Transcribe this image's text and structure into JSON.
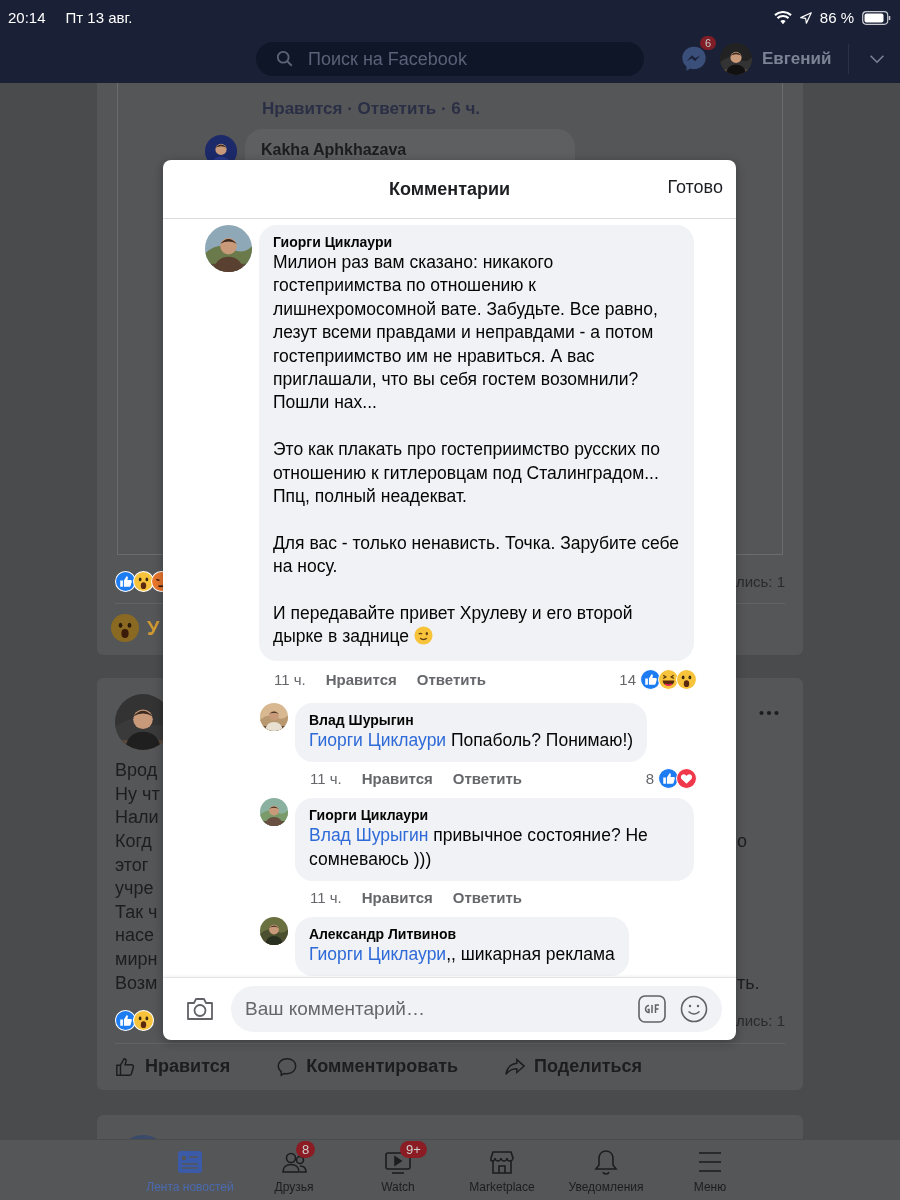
{
  "status_bar": {
    "time": "20:14",
    "date": "Пт 13 авг.",
    "battery": "86 %"
  },
  "top_bar": {
    "search_placeholder": "Поиск на Facebook",
    "messenger_badge": "6",
    "user_name": "Евгений"
  },
  "feed": {
    "post_1": {
      "comment_actions": "Нравится · Ответить · 6 ч.",
      "commenter": "Kakha Aphkhazava",
      "shares": "лись: 1",
      "reaction_label": "У"
    },
    "post_2": {
      "text_lines": [
        {
          "left": "Врод"
        },
        {
          "left": "Ну чт"
        },
        {
          "left": "Нали"
        },
        {
          "left": "Когд",
          "right": "о"
        },
        {
          "left": "этог"
        },
        {
          "left": "учре"
        },
        {
          "left": "Так ч"
        },
        {
          "left": "насе"
        },
        {
          "left": "мирн"
        },
        {
          "left": "Возм",
          "right": "ть."
        }
      ],
      "shares": "лись: 1",
      "actions": [
        "Нравится",
        "Комментировать",
        "Поделиться"
      ]
    }
  },
  "comments_dialog": {
    "title": "Комментарии",
    "done": "Готово",
    "comments": [
      {
        "author": "Гиорги Циклаури",
        "paragraphs": [
          "Милион раз вам сказано: никакого гостеприимства по отношению к лишнехромосомной вате. Забудьте. Все равно, лезут всеми правдами и неправдами - а потом гостеприимство им не нравиться. А вас приглашали, что вы себя гостем возомнили? Пошли нах...",
          "Это как плакать про гостеприимство русских по отношению к гитлеровцам под Сталинградом... Ппц, полный неадекват.",
          "Для вас - только ненависть. Точка. Зарубите себе на носу.",
          "И передавайте привет Хрулеву и его второй дырке в заднице"
        ],
        "time": "11 ч.",
        "like_label": "Нравится",
        "reply_label": "Ответить",
        "reaction_count": "14",
        "replies": [
          {
            "author": "Влад Шурыгин",
            "mention": "Гиорги Циклаури",
            "text": " Попаболь? Понимаю!)",
            "time": "11 ч.",
            "like_label": "Нравится",
            "reply_label": "Ответить",
            "reaction_count": "8"
          },
          {
            "author": "Гиорги Циклаури",
            "mention": "Влад Шурыгин",
            "text": " привычное состояние? Не сомневаюсь )))",
            "time": "11 ч.",
            "like_label": "Нравится",
            "reply_label": "Ответить"
          },
          {
            "author": "Александр Литвинов",
            "mention": "Гиорги Циклаури",
            "text": ",, шикарная реклама"
          }
        ]
      }
    ],
    "composer_placeholder": "Ваш комментарий…"
  },
  "tab_bar": [
    {
      "label": "Лента новостей",
      "selected": true
    },
    {
      "label": "Друзья",
      "selected": false,
      "badge": "8"
    },
    {
      "label": "Watch",
      "selected": false,
      "badge": "9+"
    },
    {
      "label": "Marketplace",
      "selected": false
    },
    {
      "label": "Уведомления",
      "selected": false
    },
    {
      "label": "Меню",
      "selected": false
    }
  ]
}
